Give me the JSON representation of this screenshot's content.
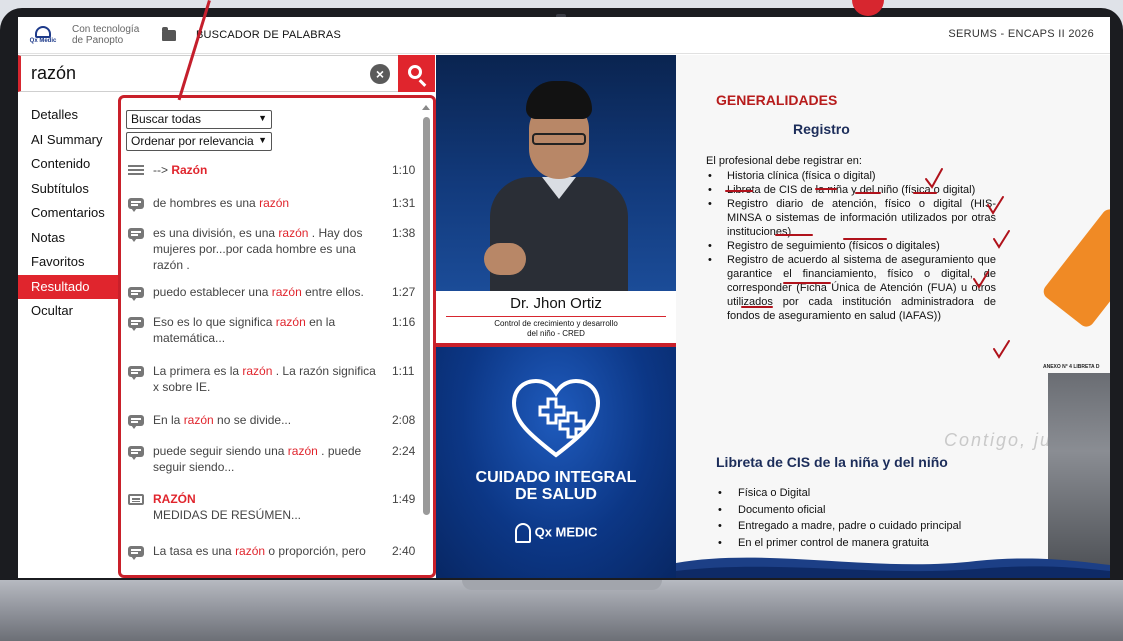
{
  "topbar": {
    "brand_text": "Qx Medic",
    "powered_by": "Con tecnología de Panopto",
    "search_title": "BUSCADOR DE PALABRAS",
    "course_title": "SERUMS - ENCAPS II 2026"
  },
  "search": {
    "query": "razón",
    "clear_label": "×"
  },
  "nav": {
    "items": [
      {
        "label": "Detalles"
      },
      {
        "label": "AI Summary"
      },
      {
        "label": "Contenido"
      },
      {
        "label": "Subtítulos"
      },
      {
        "label": "Comentarios"
      },
      {
        "label": "Notas"
      },
      {
        "label": "Favoritos"
      },
      {
        "label": "Resultado",
        "active": true
      },
      {
        "label": "Ocultar"
      }
    ]
  },
  "results": {
    "filter_scope": "Buscar todas",
    "filter_sort": "Ordenar por relevancia",
    "items": [
      {
        "icon": "list-icon",
        "pre": "--> ",
        "match": "Razón",
        "post": "",
        "time": "1:10",
        "bold": true
      },
      {
        "icon": "chat-icon",
        "pre": "de hombres es una ",
        "match": "razón",
        "post": "",
        "time": "1:31"
      },
      {
        "icon": "chat-icon",
        "pre": "es una división, es una ",
        "match": "razón",
        "post": " . Hay dos mujeres por...por cada hombre es una razón .",
        "time": "1:38"
      },
      {
        "icon": "chat-icon",
        "pre": "puedo establecer una ",
        "match": "razón",
        "post": "  entre ellos.",
        "time": "1:27"
      },
      {
        "icon": "chat-icon",
        "pre": "Eso es lo que significa ",
        "match": "razón",
        "post": "  en la matemática...",
        "time": "1:16"
      },
      {
        "icon": "chat-icon",
        "pre": "La primera es la ",
        "match": "razón",
        "post": " . La razón  significa x sobre IE.",
        "time": "1:11"
      },
      {
        "icon": "chat-icon",
        "pre": "En la ",
        "match": "razón",
        "post": "  no se divide...",
        "time": "2:08"
      },
      {
        "icon": "chat-icon",
        "pre": "puede seguir siendo una ",
        "match": "razón",
        "post": " . puede seguir siendo...",
        "time": "2:24"
      },
      {
        "icon": "doc-icon",
        "pre": "",
        "match": "RAZÓN",
        "post": "MEDIDAS DE RESÚMEN...",
        "time": "1:49",
        "bold": true
      },
      {
        "icon": "chat-icon",
        "pre": "La tasa es una ",
        "match": "razón",
        "post": "  o proporción, pero",
        "time": "2:40"
      }
    ]
  },
  "video": {
    "presenter_name": "Dr. Jhon Ortiz",
    "presenter_role_1": "Control de crecimiento y desarrollo",
    "presenter_role_2": "del niño - CRED",
    "course_line_1": "CUIDADO INTEGRAL",
    "course_line_2": "DE SALUD",
    "brand": "Qx MEDIC"
  },
  "slide": {
    "heading": "GENERALIDADES",
    "subheading": "Registro",
    "intro": "El profesional debe registrar en:",
    "bullets": [
      "Historia clínica (física o digital)",
      "Libreta de CIS de la niña y del niño (física o digital)",
      "Registro diario de atención, físico o digital (HIS- MINSA o sistemas de información utilizados por otras instituciones)",
      "Registro de seguimiento (físicos o digitales)",
      "Registro de acuerdo al sistema de aseguramiento que garantice el financiamiento, físico o digital, de corresponder (Ficha Única de Atención (FUA) u otros utilizados por cada institución administradora de fondos de aseguramiento en salud (IAFAS))"
    ],
    "heading2": "Libreta de CIS de la niña y del niño",
    "bullets2": [
      "Física o Digital",
      "Documento oficial",
      "Entregado a madre, padre o cuidado principal",
      "En el primer control de manera gratuita"
    ],
    "watermark": "Contigo, juntos",
    "annex_label": "ANEXO N° 4  LIBRETA D"
  },
  "colors": {
    "accent": "#e0252d",
    "frame": "#c9202a",
    "slide_heading": "#b71c1c",
    "slide_subheading": "#1c2d5a"
  }
}
